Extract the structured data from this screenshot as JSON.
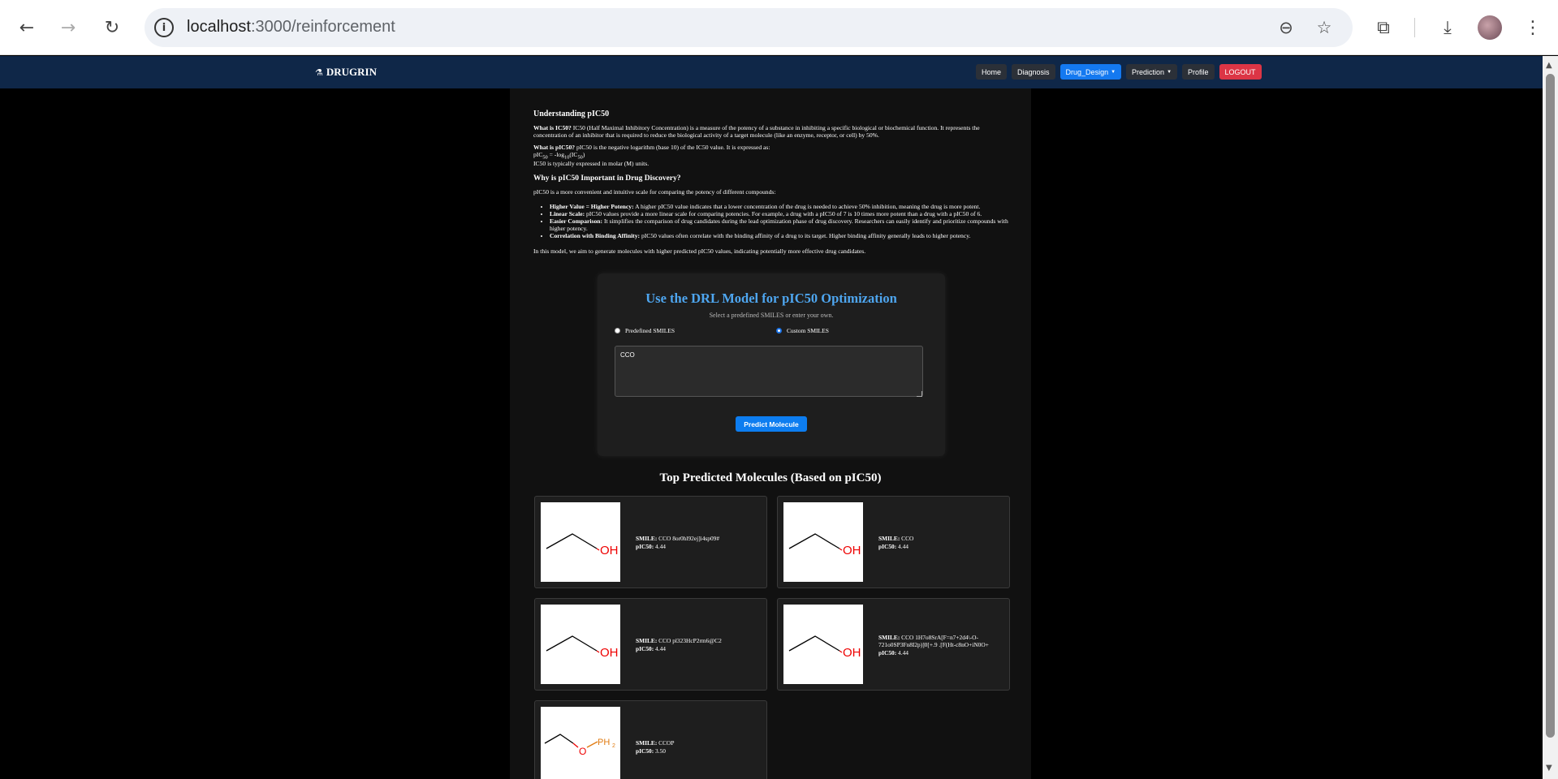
{
  "browser": {
    "url_host": "localhost",
    "url_path": ":3000/reinforcement",
    "icons": {
      "back": "back-arrow-icon",
      "forward": "forward-arrow-icon",
      "reload": "reload-icon",
      "info": "site-info-icon",
      "zoom": "zoom-out-icon",
      "bookmark": "star-icon",
      "extensions": "puzzle-icon",
      "download": "download-icon",
      "menu": "kebab-menu-icon"
    }
  },
  "nav": {
    "brand": "DRUGRIN",
    "links": {
      "home": "Home",
      "diagnosis": "Diagnosis",
      "drug_design": "Drug_Design",
      "prediction": "Prediction",
      "profile": "Profile",
      "logout": "LOGOUT"
    },
    "colors": {
      "bar": "#0f2748",
      "active": "#1479f0",
      "logout": "#dc3545"
    }
  },
  "info": {
    "heading": "Understanding pIC50",
    "ic50_label": "What is IC50?",
    "ic50_text": " IC50 (Half Maximal Inhibitory Concentration) is a measure of the potency of a substance in inhibiting a specific biological or biochemical function. It represents the concentration of an inhibitor that is required to reduce the biological activity of a target molecule (like an enzyme, receptor, or cell) by 50%.",
    "pic50_label": "What is pIC50?",
    "pic50_text": " pIC50 is the negative logarithm (base 10) of the IC50 value. It is expressed as:",
    "formula_lhs": "pIC",
    "formula_lhs_sub": "50",
    "formula_mid": " = -log",
    "formula_log_sub": "10",
    "formula_ic": "(IC",
    "formula_ic_sub": "50",
    "formula_end": ")",
    "units_text": "IC50 is typically expressed in molar (M) units.",
    "why_heading": "Why is pIC50 Important in Drug Discovery?",
    "why_intro": "pIC50 is a more convenient and intuitive scale for comparing the potency of different compounds:",
    "bullets": [
      {
        "label": "Higher Value = Higher Potency:",
        "text": " A higher pIC50 value indicates that a lower concentration of the drug is needed to achieve 50% inhibition, meaning the drug is more potent."
      },
      {
        "label": "Linear Scale:",
        "text": " pIC50 values provide a more linear scale for comparing potencies. For example, a drug with a pIC50 of 7 is 10 times more potent than a drug with a pIC50 of 6."
      },
      {
        "label": "Easier Comparison:",
        "text": " It simplifies the comparison of drug candidates during the lead optimization phase of drug discovery. Researchers can easily identify and prioritize compounds with higher potency."
      },
      {
        "label": "Correlation with Binding Affinity:",
        "text": " pIC50 values often correlate with the binding affinity of a drug to its target. Higher binding affinity generally leads to higher potency."
      }
    ],
    "closing": "In this model, we aim to generate molecules with higher predicted pIC50 values, indicating potentially more effective drug candidates."
  },
  "model_card": {
    "title": "Use the DRL Model for pIC50 Optimization",
    "subtitle": "Select a predefined SMILES or enter your own.",
    "radio_predefined": "Predefined SMILES",
    "radio_custom": "Custom SMILES",
    "selected": "custom",
    "input_value": "CCO",
    "button": "Predict Molecule"
  },
  "results": {
    "title": "Top Predicted Molecules (Based on pIC50)",
    "smile_label": "SMILE:",
    "pic50_label": "pIC50:",
    "molecules": [
      {
        "smile": " CCO 8or0hl92ej]i4sp09#",
        "pic50": " 4.44",
        "structure": "ethanol"
      },
      {
        "smile": " CCO",
        "pic50": " 4.44",
        "structure": "ethanol"
      },
      {
        "smile": " CCO pl323HcP2rm6@C2",
        "pic50": " 4.44",
        "structure": "ethanol"
      },
      {
        "smile": " CCO 1H7o8SrA[F=n7+2d4\\-O-721o0SP3Fn8I2p)]0[+.9 .[F(Ht-c8nO+iN0O+",
        "pic50": " 4.44",
        "structure": "ethanol"
      },
      {
        "smile": " CCOP",
        "pic50": " 3.50",
        "structure": "ethyl-phosphine-ether"
      }
    ]
  }
}
